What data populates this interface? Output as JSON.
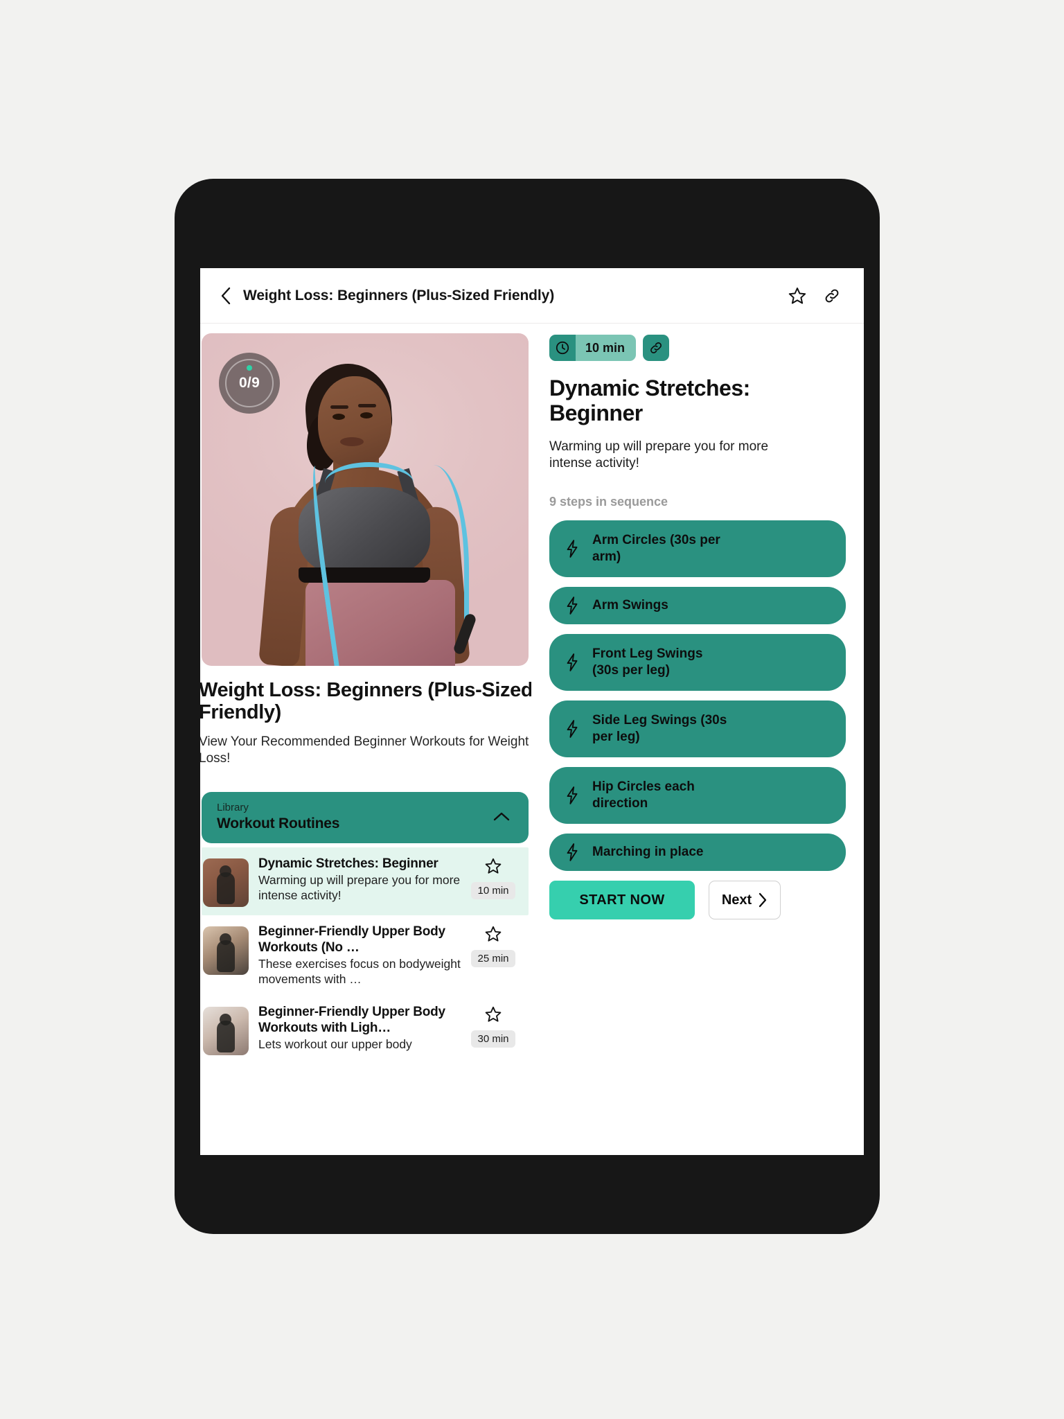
{
  "header": {
    "back_icon": "chevron-left-icon",
    "title": "Weight Loss: Beginners (Plus-Sized Friendly)",
    "favorite_icon": "star-outline-icon",
    "share_icon": "link-icon"
  },
  "left": {
    "progress": "0/9",
    "title": "Weight Loss: Beginners (Plus-Sized Friendly)",
    "subtitle": "View Your Recommended Beginner Workouts for Weight Loss!",
    "library": {
      "eyebrow": "Library",
      "title": "Workout Routines",
      "collapse_icon": "chevron-up-icon"
    },
    "routines": [
      {
        "title": "Dynamic Stretches: Beginner",
        "desc": "Warming up will prepare you for more intense activity!",
        "time": "10 min",
        "favorite_icon": "star-outline-icon",
        "selected": true
      },
      {
        "title": "Beginner-Friendly Upper Body Workouts (No …",
        "desc": "These exercises focus on bodyweight movements with …",
        "time": "25 min",
        "favorite_icon": "star-outline-icon",
        "selected": false
      },
      {
        "title": "Beginner-Friendly Upper Body Workouts with Ligh…",
        "desc": "Lets workout our upper body",
        "time": "30 min",
        "favorite_icon": "star-outline-icon",
        "selected": false
      }
    ]
  },
  "right": {
    "duration_badge": {
      "icon": "clock-icon",
      "label": "10 min"
    },
    "share_badge_icon": "link-icon",
    "title": "Dynamic Stretches: Beginner",
    "description": "Warming up will prepare you for more intense activity!",
    "steps_label": "9 steps in sequence",
    "steps": [
      {
        "icon": "bolt-icon",
        "label": "Arm Circles (30s per arm)"
      },
      {
        "icon": "bolt-icon",
        "label": "Arm Swings"
      },
      {
        "icon": "bolt-icon",
        "label": "Front Leg Swings (30s per leg)"
      },
      {
        "icon": "bolt-icon",
        "label": "Side Leg Swings (30s per leg)"
      },
      {
        "icon": "bolt-icon",
        "label": "Hip Circles each direction"
      },
      {
        "icon": "bolt-icon",
        "label": "Marching in place"
      }
    ],
    "start_label": "START NOW",
    "next_label": "Next",
    "next_icon": "chevron-right-icon"
  },
  "colors": {
    "accent_teal": "#2a9180",
    "accent_teal_light": "#7bc5b4",
    "start_green": "#36cfae",
    "selected_row": "#e3f5ee",
    "page_bg": "#f2f2f0",
    "bezel": "#171717"
  }
}
